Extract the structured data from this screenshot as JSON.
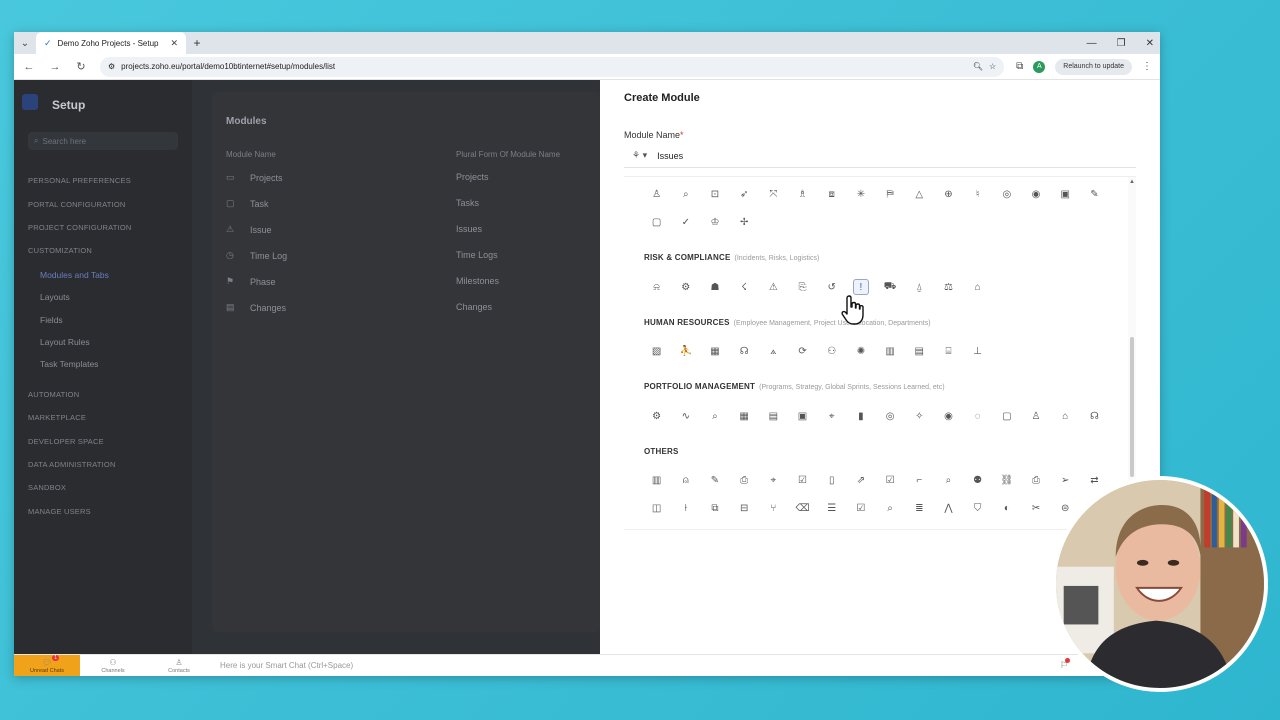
{
  "browser": {
    "tab_title": "Demo Zoho Projects - Setup",
    "url": "projects.zoho.eu/portal/demo10btinternet#setup/modules/list",
    "relaunch_label": "Relaunch to update",
    "profile_initial": "A"
  },
  "sidebar": {
    "title": "Setup",
    "search_placeholder": "Search here",
    "sections": [
      "PERSONAL PREFERENCES",
      "PORTAL CONFIGURATION",
      "PROJECT CONFIGURATION",
      "CUSTOMIZATION"
    ],
    "customization_items": [
      "Modules and Tabs",
      "Layouts",
      "Fields",
      "Layout Rules",
      "Task Templates"
    ],
    "more_sections": [
      "AUTOMATION",
      "MARKETPLACE",
      "DEVELOPER SPACE",
      "DATA ADMINISTRATION",
      "SANDBOX",
      "MANAGE USERS"
    ]
  },
  "modules": {
    "title": "Modules",
    "col_name": "Module Name",
    "col_plural": "Plural Form Of Module Name",
    "rows": [
      {
        "name": "Projects",
        "plural": "Projects"
      },
      {
        "name": "Task",
        "plural": "Tasks"
      },
      {
        "name": "Issue",
        "plural": "Issues"
      },
      {
        "name": "Time Log",
        "plural": "Time Logs"
      },
      {
        "name": "Phase",
        "plural": "Milestones"
      },
      {
        "name": "Changes",
        "plural": "Changes"
      }
    ]
  },
  "create_module": {
    "title": "Create Module",
    "field_label": "Module Name",
    "required_mark": "*",
    "name_value": "Issues",
    "sections": [
      {
        "title": "RISK & COMPLIANCE",
        "subtitle": "(Incidents, Risks, Logistics)"
      },
      {
        "title": "HUMAN RESOURCES",
        "subtitle": "(Employee Management, Project User Allocation, Departments)"
      },
      {
        "title": "PORTFOLIO MANAGEMENT",
        "subtitle": "(Programs, Strategy, Global Sprints, Sessions Learned, etc)"
      },
      {
        "title": "OTHERS",
        "subtitle": ""
      }
    ]
  },
  "bottombar": {
    "unread_label": "Unread Chats",
    "unread_count": "1",
    "channels_label": "Channels",
    "contacts_label": "Contacts",
    "smartchat_placeholder": "Here is your Smart Chat (Ctrl+Space)"
  },
  "colors": {
    "accent": "#2a5fd8",
    "unread": "#f0a21a",
    "background": "#3bbfd6"
  }
}
